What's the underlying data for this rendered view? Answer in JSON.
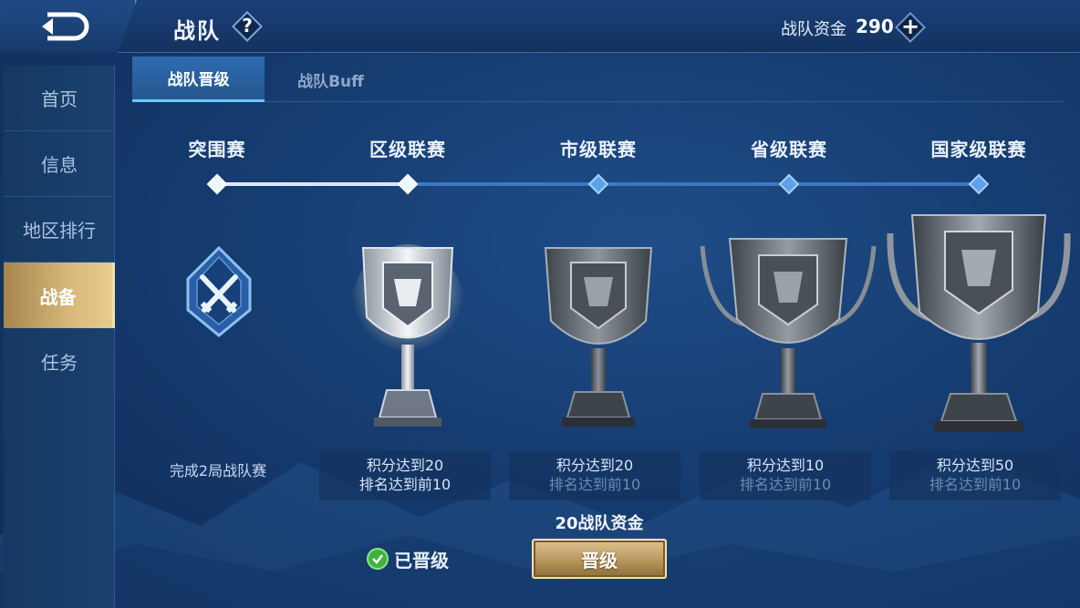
{
  "header": {
    "title": "战队",
    "help_symbol": "?",
    "fund_label": "战队资金",
    "fund_value": "290",
    "add_symbol": "+"
  },
  "sidebar": {
    "items": [
      {
        "label": "首页",
        "active": false
      },
      {
        "label": "信息",
        "active": false
      },
      {
        "label": "地区排行",
        "active": false
      },
      {
        "label": "战备",
        "active": true
      },
      {
        "label": "任务",
        "active": false
      }
    ]
  },
  "tabs": [
    {
      "label": "战队晋级",
      "active": true
    },
    {
      "label": "战队Buff",
      "active": false
    }
  ],
  "stages": [
    {
      "name": "突围赛",
      "icon": "swords-badge-icon",
      "requirement": [
        "完成2局战队赛"
      ],
      "status": "completed"
    },
    {
      "name": "区级联赛",
      "icon": "silver-trophy-icon",
      "requirement": [
        "积分达到20",
        "排名达到前10"
      ],
      "status": "completed"
    },
    {
      "name": "市级联赛",
      "icon": "dark-trophy-icon",
      "requirement": [
        "积分达到20",
        "排名达到前10"
      ],
      "status": "locked"
    },
    {
      "name": "省级联赛",
      "icon": "dark-trophy-handles-icon",
      "requirement": [
        "积分达到10",
        "排名达到前10"
      ],
      "status": "locked"
    },
    {
      "name": "国家级联赛",
      "icon": "large-trophy-icon",
      "requirement": [
        "积分达到50",
        "排名达到前10"
      ],
      "status": "locked"
    }
  ],
  "actions": {
    "promoted_label": "已晋级",
    "cost_label": "20战队资金",
    "promote_button": "晋级"
  },
  "colors": {
    "background": "#163c70",
    "active_tab": "#2e6cb0",
    "gold_accent": "#d8b77a",
    "track": "#3b78c4",
    "check_green": "#3fb23f"
  }
}
